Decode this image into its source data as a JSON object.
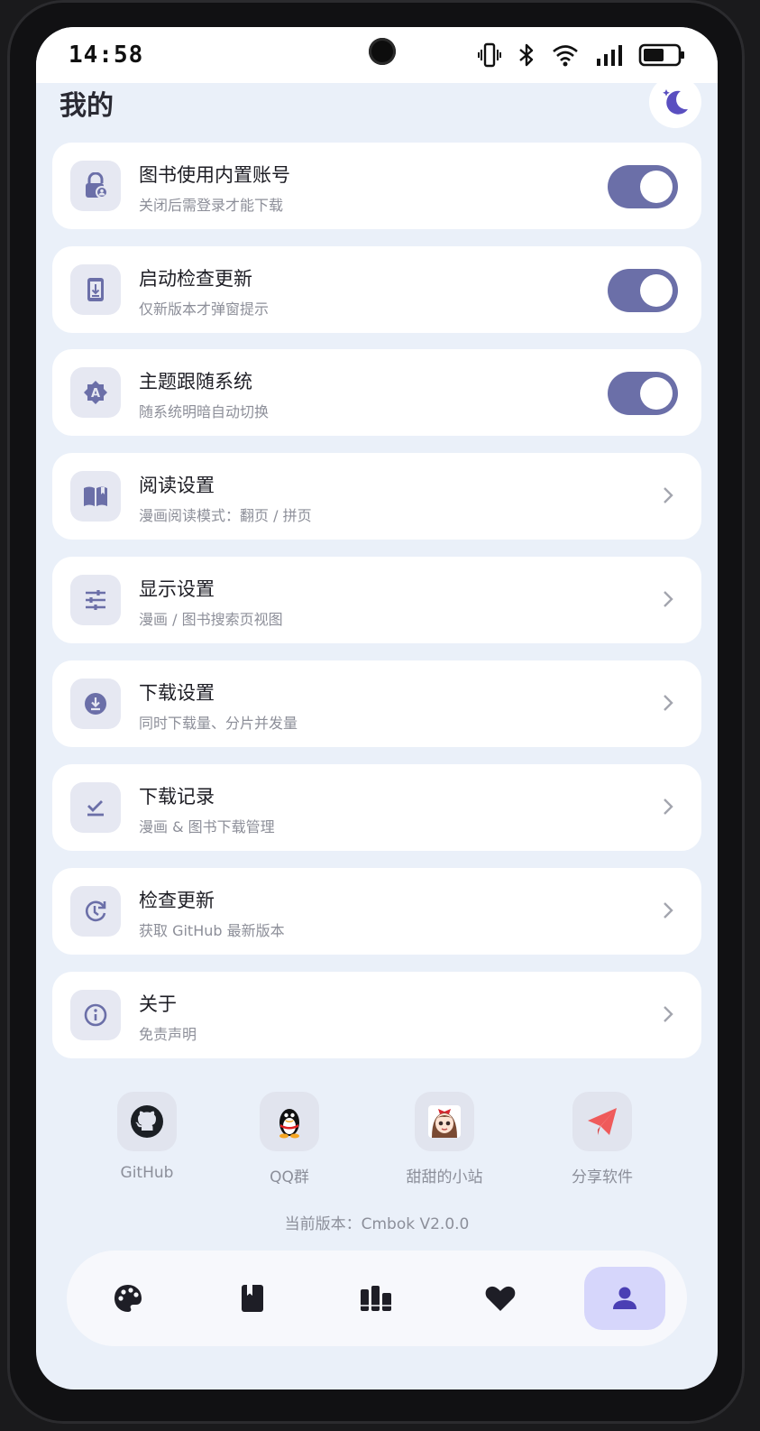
{
  "status_bar": {
    "time": "14:58"
  },
  "header": {
    "title": "我的",
    "theme_icon": "moon-stars-icon"
  },
  "settings": [
    {
      "title": "图书使用内置账号",
      "subtitle": "关闭后需登录才能下载",
      "icon": "lock-person-icon",
      "control": "toggle",
      "on": true
    },
    {
      "title": "启动检查更新",
      "subtitle": "仅新版本才弹窗提示",
      "icon": "phone-download-icon",
      "control": "toggle",
      "on": true
    },
    {
      "title": "主题跟随系统",
      "subtitle": "随系统明暗自动切换",
      "icon": "auto-theme-icon",
      "control": "toggle",
      "on": true
    },
    {
      "title": "阅读设置",
      "subtitle": "漫画阅读模式：翻页 / 拼页",
      "icon": "book-open-icon",
      "control": "chevron"
    },
    {
      "title": "显示设置",
      "subtitle": "漫画 / 图书搜索页视图",
      "icon": "tune-icon",
      "control": "chevron"
    },
    {
      "title": "下载设置",
      "subtitle": "同时下载量、分片并发量",
      "icon": "download-circle-icon",
      "control": "chevron"
    },
    {
      "title": "下载记录",
      "subtitle": "漫画 & 图书下载管理",
      "icon": "download-done-icon",
      "control": "chevron"
    },
    {
      "title": "检查更新",
      "subtitle": "获取 GitHub 最新版本",
      "icon": "update-icon",
      "control": "chevron"
    },
    {
      "title": "关于",
      "subtitle": "免责声明",
      "icon": "info-icon",
      "control": "chevron"
    }
  ],
  "links": [
    {
      "label": "GitHub",
      "icon": "github-icon"
    },
    {
      "label": "QQ群",
      "icon": "qq-penguin-icon"
    },
    {
      "label": "甜甜的小站",
      "icon": "avatar-girl-icon"
    },
    {
      "label": "分享软件",
      "icon": "paper-plane-icon"
    }
  ],
  "version": "当前版本：Cmbok V2.0.0",
  "bottom_nav": [
    {
      "icon": "palette-icon",
      "active": false
    },
    {
      "icon": "book-icon",
      "active": false
    },
    {
      "icon": "library-icon",
      "active": false
    },
    {
      "icon": "heart-icon",
      "active": false
    },
    {
      "icon": "person-icon",
      "active": true
    }
  ],
  "colors": {
    "accent": "#6b6fa8",
    "background": "#eaf0f9",
    "nav_active": "#d6d6fb"
  }
}
